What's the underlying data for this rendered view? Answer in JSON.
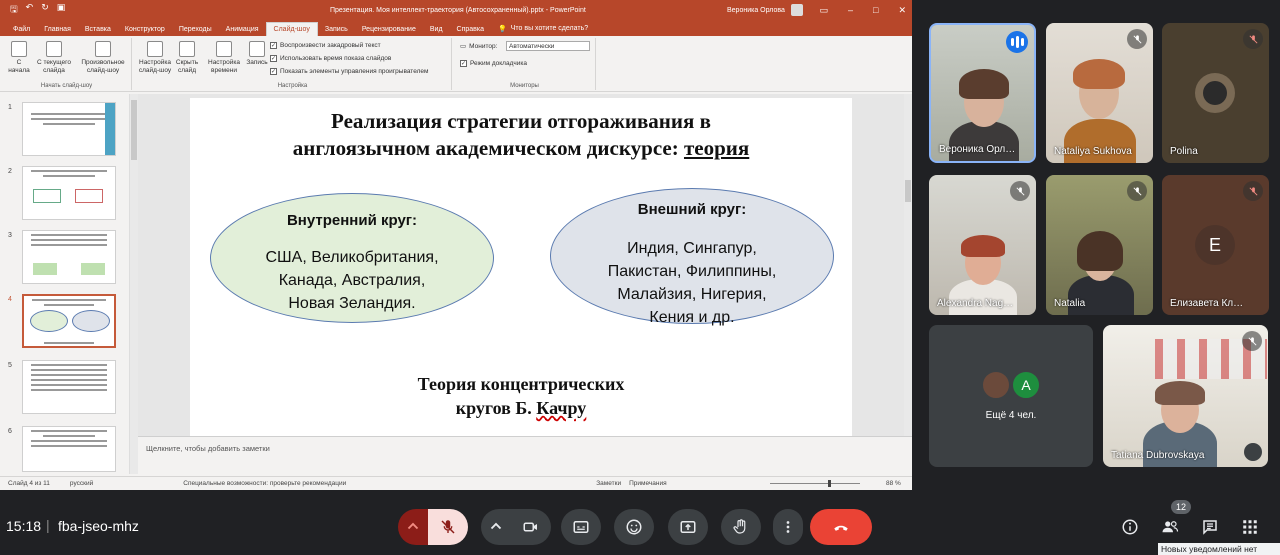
{
  "ppt": {
    "title_bar": {
      "document": "Презентация. Моя интеллект-траектория (Автосохраненный).pptx  -  PowerPoint",
      "user": "Вероника Орлова"
    },
    "tabs": [
      "Файл",
      "Главная",
      "Вставка",
      "Конструктор",
      "Переходы",
      "Анимация",
      "Слайд-шоу",
      "Запись",
      "Рецензирование",
      "Вид",
      "Справка"
    ],
    "active_tab": "Слайд-шоу",
    "search_label": "Что вы хотите сделать?",
    "ribbon": {
      "group_start": "Начать слайд-шоу",
      "btn_from_start": "С начала",
      "btn_from_current": "С текущего слайда",
      "btn_custom": "Произвольное слайд-шоу",
      "btn_setup": "Настройка слайд-шоу",
      "btn_hide": "Скрыть слайд",
      "btn_timing": "Настройка времени",
      "btn_record": "Запись",
      "group_setup": "Настройка",
      "chk_narration": "Воспроизвести закадровый текст",
      "chk_timings": "Использовать время показа слайдов",
      "chk_controls": "Показать элементы управления проигрывателем",
      "monitor_label": "Монитор:",
      "monitor_value": "Автоматически",
      "chk_presenter": "Режим докладчика",
      "group_monitors": "Мониторы"
    },
    "thumbnail_numbers": [
      "1",
      "2",
      "3",
      "4",
      "5",
      "6"
    ],
    "slide": {
      "title_line1": "Реализация стратегии отгораживания в",
      "title_line2_prefix": "англоязычном академическом дискурсе: ",
      "title_line2_underlined": "теория",
      "inner_heading": "Внутренний круг:",
      "inner_line1": "США, Великобритания,",
      "inner_line2": "Канада, Австралия,",
      "inner_line3": "Новая Зеландия.",
      "outer_heading": "Внешний круг:",
      "outer_line1": "Индия, Сингапур,",
      "outer_line2": "Пакистан, Филиппины,",
      "outer_line3": "Малайзия, Нигерия,",
      "outer_line4": "Кения и др.",
      "caption_line1": "Теория концентрических",
      "caption_line2_prefix": "кругов Б. ",
      "caption_line2_wavy": "Качру"
    },
    "notes_placeholder": "Щелкните, чтобы добавить заметки",
    "status": {
      "slide_counter": "Слайд 4 из 11",
      "language": "русский",
      "accessibility": "Специальные возможности: проверьте рекомендации",
      "notes": "Заметки",
      "comments": "Примечания",
      "zoom": "88 %"
    }
  },
  "participants": [
    {
      "name": "Вероника Орл…",
      "speaking": true
    },
    {
      "name": "Nataliya Sukhova",
      "muted": true
    },
    {
      "name": "Polina",
      "muted": true
    },
    {
      "name": "Alexandra Nag…",
      "muted": true
    },
    {
      "name": "Natalia",
      "muted": true
    },
    {
      "name": "Елизавета Кл…",
      "muted": true,
      "avatar_letter": "E"
    },
    {
      "name": "Ещё 4 чел.",
      "avatar_letter": "A"
    },
    {
      "name": "Tatiana Dubrovskaya",
      "muted": true
    }
  ],
  "meet": {
    "time": "15:18",
    "separator": "|",
    "code": "fba-jseo-mhz",
    "people_count": "12",
    "tooltip": "Новых уведомлений нет"
  },
  "colors": {
    "ppt_accent": "#b7472a",
    "meet_bg": "#202124",
    "end_call": "#ea4335",
    "inner_circle": "#e2efd9",
    "outer_circle": "#dfe3ea"
  }
}
